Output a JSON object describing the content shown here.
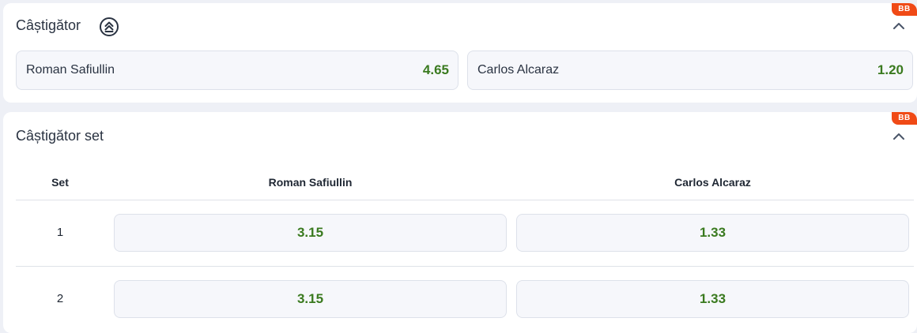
{
  "market_winner": {
    "title": "Câștigător",
    "badge": "BB",
    "icon": "stacked-chevrons-up-icon",
    "collapse_icon": "chevron-up-icon",
    "selections": [
      {
        "name": "Roman Safiullin",
        "odds": "4.65"
      },
      {
        "name": "Carlos Alcaraz",
        "odds": "1.20"
      }
    ]
  },
  "market_set_winner": {
    "title": "Câștigător set",
    "badge": "BB",
    "collapse_icon": "chevron-up-icon",
    "columns": {
      "set": "Set",
      "player1": "Roman Safiullin",
      "player2": "Carlos Alcaraz"
    },
    "rows": [
      {
        "set": "1",
        "player1_odds": "3.15",
        "player2_odds": "1.33"
      },
      {
        "set": "2",
        "player1_odds": "3.15",
        "player2_odds": "1.33"
      }
    ]
  },
  "colors": {
    "odds_green": "#3a7a1f",
    "badge_orange": "#f04a16",
    "background": "#eef0f6"
  }
}
